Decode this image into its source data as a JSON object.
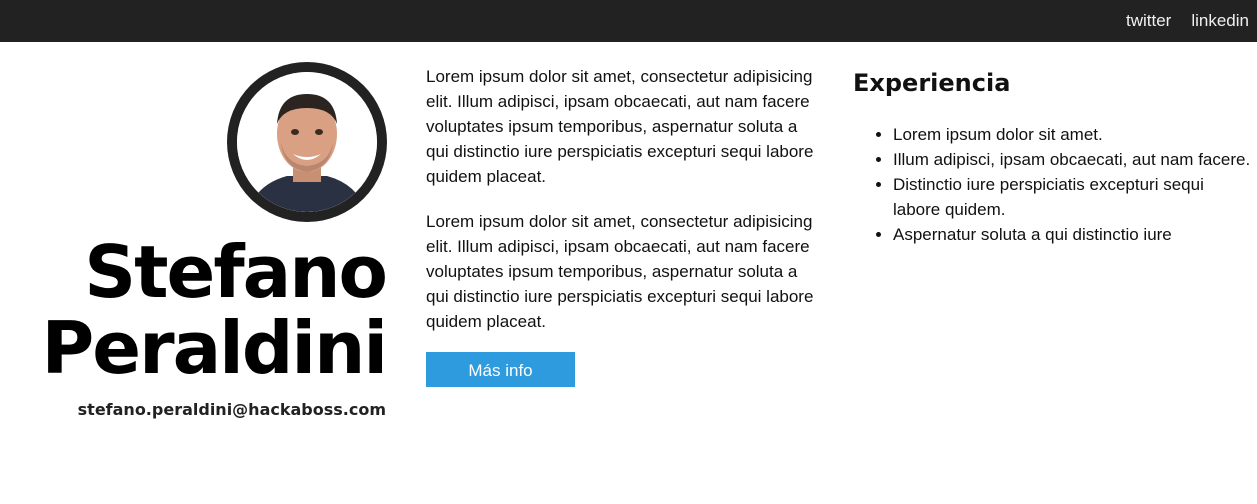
{
  "nav": {
    "links": [
      "twitter",
      "linkedin"
    ]
  },
  "profile": {
    "first_name": "Stefano",
    "last_name": "Peraldini",
    "email": "stefano.peraldini@hackaboss.com"
  },
  "bio": {
    "paragraphs": [
      "Lorem ipsum dolor sit amet, consectetur adipisicing elit. Illum adipisci, ipsam obcaecati, aut nam facere voluptates ipsum temporibus, aspernatur soluta a qui distinctio iure perspiciatis excepturi sequi labore quidem placeat.",
      "Lorem ipsum dolor sit amet, consectetur adipisicing elit. Illum adipisci, ipsam obcaecati, aut nam facere voluptates ipsum temporibus, aspernatur soluta a qui distinctio iure perspiciatis excepturi sequi labore quidem placeat."
    ],
    "button_label": "Más info"
  },
  "experience": {
    "title": "Experiencia",
    "items": [
      "Lorem ipsum dolor sit amet.",
      "Illum adipisci, ipsam obcaecati, aut nam facere.",
      "Distinctio iure perspiciatis excepturi sequi labore quidem.",
      "Aspernatur soluta a qui distinctio iure"
    ]
  },
  "colors": {
    "topbar": "#222222",
    "button": "#2e9bdf",
    "avatar_ring": "#222222"
  }
}
